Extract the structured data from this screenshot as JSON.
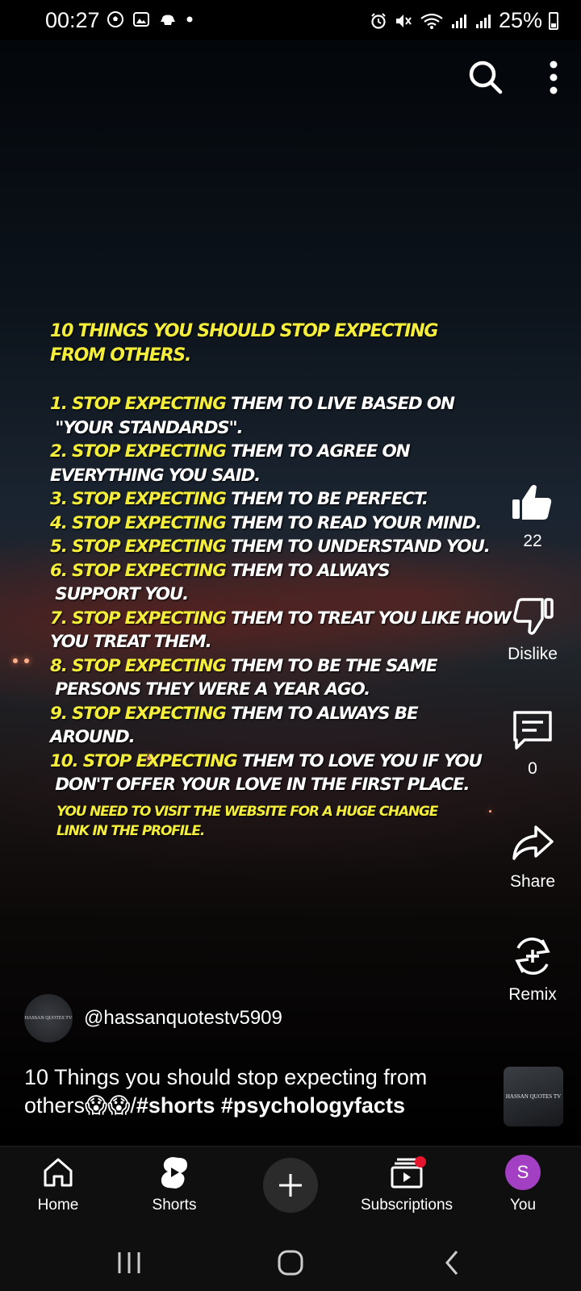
{
  "status_bar": {
    "time": "00:27",
    "battery": "25%"
  },
  "icons": {
    "search": "search-icon",
    "more": "more-vert-icon",
    "like": "thumb-up-icon",
    "dislike": "thumb-down-icon",
    "comments": "comment-icon",
    "share": "share-icon",
    "remix": "remix-icon"
  },
  "overlay": {
    "title_line1": "10 THINGS YOU SHOULD STOP EXPECTING",
    "title_line2": " FROM OTHERS.",
    "items": [
      {
        "prefix": "1. STOP EXPECTING",
        "rest": " THEM TO LIVE BASED ON",
        "cont": " \"YOUR STANDARDS\"."
      },
      {
        "prefix": "2. STOP EXPECTING",
        "rest": " THEM TO AGREE ON",
        "cont": "EVERYTHING YOU SAID."
      },
      {
        "prefix": "3. STOP EXPECTING",
        "rest": " THEM TO BE PERFECT.",
        "cont": ""
      },
      {
        "prefix": "4. STOP EXPECTING",
        "rest": " THEM TO READ YOUR MIND.",
        "cont": ""
      },
      {
        "prefix": "5. STOP EXPECTING",
        "rest": " THEM TO UNDERSTAND YOU.",
        "cont": ""
      },
      {
        "prefix": "6. STOP EXPECTING",
        "rest": " THEM TO ALWAYS",
        "cont": " SUPPORT YOU."
      },
      {
        "prefix": "7. STOP EXPECTING",
        "rest": " THEM TO TREAT YOU LIKE HOW",
        "cont": "YOU TREAT THEM."
      },
      {
        "prefix": "8. STOP EXPECTING",
        "rest": " THEM TO BE THE SAME",
        "cont": " PERSONS THEY WERE A YEAR AGO."
      },
      {
        "prefix": "9. STOP EXPECTING",
        "rest": " THEM TO ALWAYS BE",
        "cont": "AROUND."
      },
      {
        "prefix": "10. STOP EXPECTING",
        "rest": " THEM TO LOVE YOU IF YOU",
        "cont": " DON'T OFFER YOUR LOVE IN THE FIRST PLACE."
      }
    ],
    "footer_line1": "YOU NEED TO VISIT THE WEBSITE FOR A HUGE CHANGE",
    "footer_line2": "LINK IN THE PROFILE."
  },
  "rail": {
    "like_count": "22",
    "dislike_label": "Dislike",
    "comment_count": "0",
    "share_label": "Share",
    "remix_label": "Remix"
  },
  "channel": {
    "handle": "@hassanquotestv5909",
    "logo_text": "HASSAN QUOTES TV"
  },
  "video": {
    "title_text": "10 Things you should stop expecting from others😱😱/",
    "hashtags": "#shorts #psychologyfacts"
  },
  "nav": {
    "home": "Home",
    "shorts": "Shorts",
    "subscriptions": "Subscriptions",
    "you": "You",
    "you_initial": "S"
  },
  "colors": {
    "highlight": "#f4ee3a",
    "you_avatar": "#a33fc2",
    "notification_dot": "#e6142d"
  }
}
